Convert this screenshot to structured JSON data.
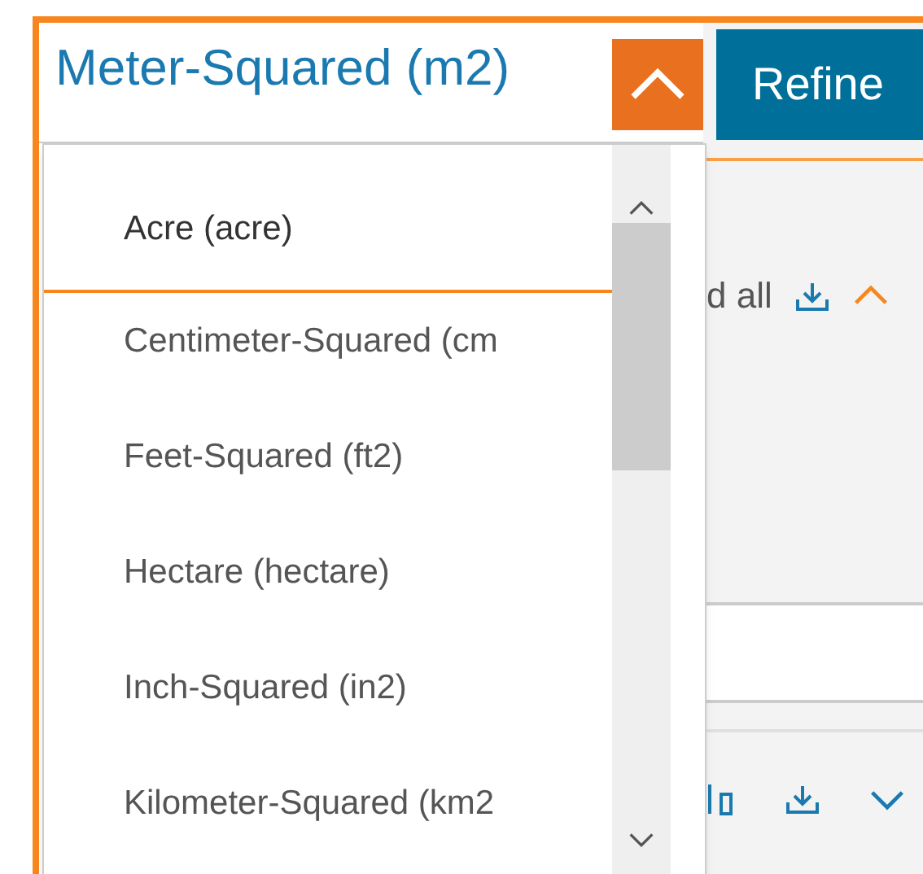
{
  "dropdown": {
    "value": "Meter-Squared (m2)",
    "expanded": true,
    "options": [
      {
        "label": "Acre (acre)",
        "selected": true
      },
      {
        "label": "Centimeter-Squared (cm",
        "selected": false
      },
      {
        "label": "Feet-Squared (ft2)",
        "selected": false
      },
      {
        "label": "Hectare (hectare)",
        "selected": false
      },
      {
        "label": "Inch-Squared (in2)",
        "selected": false
      },
      {
        "label": "Kilometer-Squared (km2",
        "selected": false
      }
    ]
  },
  "refine_button": {
    "label": "Refine"
  },
  "background_panel": {
    "download_all_label": "d all"
  }
}
